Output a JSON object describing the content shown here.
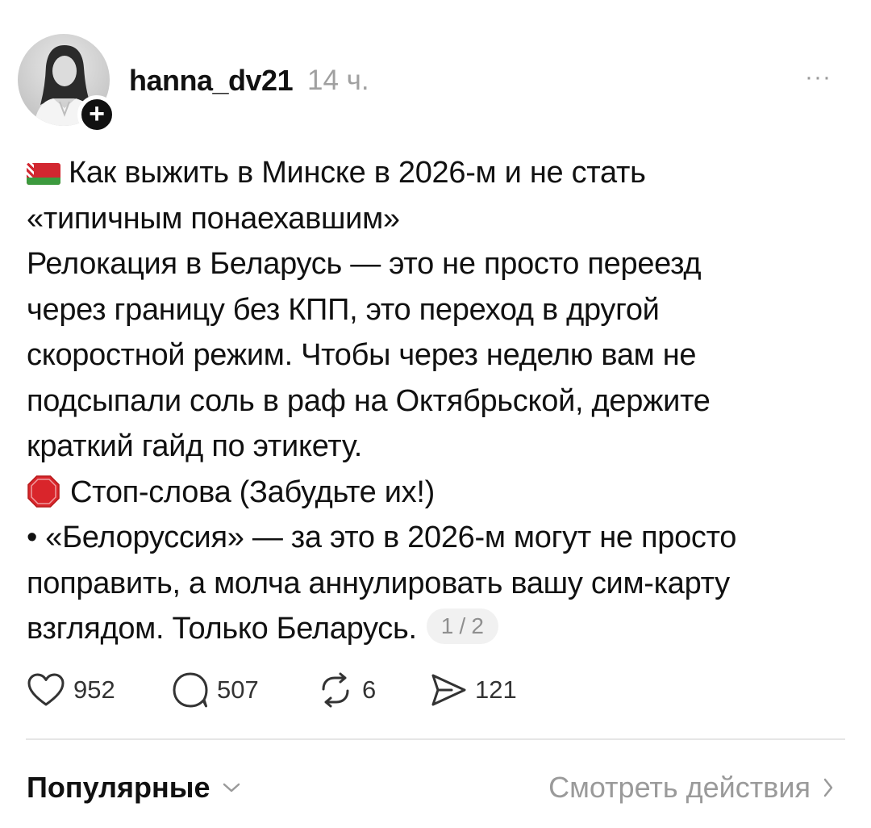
{
  "post": {
    "username": "hanna_dv21",
    "time": "14 ч.",
    "more": "···",
    "follow": "+",
    "lines": [
      "Как выжить в Минске в 2026-м и не стать",
      "«типичным понаехавшим»",
      "Релокация в Беларусь — это не просто переезд",
      "через границу без КПП, это переход в другой",
      "скоростной режим. Чтобы через неделю вам не",
      "подсыпали соль в раф на Октябрьской, держите",
      "краткий гайд по этикету.",
      "Стоп-слова (Забудьте их!)",
      "• «Белоруссия» — за это в 2026-м могут не просто",
      "поправить, а молча аннулировать вашу сим-карту",
      "взглядом. Только Беларусь."
    ],
    "pager": "1 / 2",
    "icons": {
      "flag": "belarus-flag-icon",
      "stop": "stop-sign-icon"
    }
  },
  "actions": {
    "likes": "952",
    "comments": "507",
    "reposts": "6",
    "shares": "121"
  },
  "footer": {
    "sort_label": "Популярные",
    "view_activity": "Смотреть действия"
  },
  "colors": {
    "text": "#111111",
    "muted": "#9a9a9a",
    "flag_red": "#d22730",
    "flag_green": "#3c9a3e",
    "stop_red": "#d9252b"
  }
}
